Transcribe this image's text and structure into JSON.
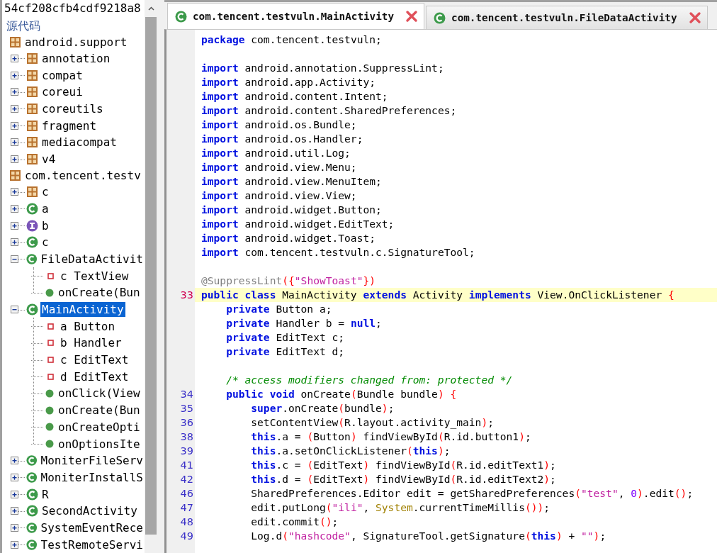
{
  "tree": {
    "title": "54cf208cfb4cdf9218a8",
    "root": "源代码",
    "children": [
      {
        "kind": "package",
        "label": "android.support",
        "selected": false,
        "children": [
          {
            "kind": "package",
            "label": "annotation",
            "expanded": false,
            "selected": false
          },
          {
            "kind": "package",
            "label": "compat",
            "expanded": false,
            "selected": false
          },
          {
            "kind": "package",
            "label": "coreui",
            "expanded": false,
            "selected": false
          },
          {
            "kind": "package",
            "label": "coreutils",
            "expanded": false,
            "selected": false
          },
          {
            "kind": "package",
            "label": "fragment",
            "expanded": false,
            "selected": false
          },
          {
            "kind": "package",
            "label": "mediacompat",
            "expanded": false,
            "selected": false
          },
          {
            "kind": "package",
            "label": "v4",
            "expanded": false,
            "selected": false
          }
        ]
      },
      {
        "kind": "package",
        "label": "com.tencent.testv",
        "selected": false,
        "children": [
          {
            "kind": "package",
            "label": "c",
            "expanded": false,
            "selected": false
          },
          {
            "kind": "class",
            "label": "a",
            "expanded": false,
            "selected": false
          },
          {
            "kind": "interface",
            "label": "b",
            "expanded": false,
            "selected": false
          },
          {
            "kind": "class",
            "label": "c",
            "expanded": false,
            "selected": false
          },
          {
            "kind": "class",
            "label": "FileDataActivit",
            "expanded": true,
            "selected": false,
            "children": [
              {
                "kind": "field",
                "label": "c TextView",
                "selected": false
              },
              {
                "kind": "method",
                "label": "onCreate(Bun",
                "selected": false
              }
            ]
          },
          {
            "kind": "class",
            "label": "MainActivity",
            "expanded": true,
            "selected": true,
            "children": [
              {
                "kind": "field",
                "label": "a Button",
                "selected": false
              },
              {
                "kind": "field",
                "label": "b Handler",
                "selected": false
              },
              {
                "kind": "field",
                "label": "c EditText",
                "selected": false
              },
              {
                "kind": "field",
                "label": "d EditText",
                "selected": false
              },
              {
                "kind": "method",
                "label": "onClick(View",
                "selected": false
              },
              {
                "kind": "method",
                "label": "onCreate(Bun",
                "selected": false
              },
              {
                "kind": "method",
                "label": "onCreateOpti",
                "selected": false
              },
              {
                "kind": "method",
                "label": "onOptionsIte",
                "selected": false
              }
            ]
          },
          {
            "kind": "class",
            "label": "MoniterFileServ",
            "expanded": false,
            "selected": false
          },
          {
            "kind": "class",
            "label": "MoniterInstallS",
            "expanded": false,
            "selected": false
          },
          {
            "kind": "class",
            "label": "R",
            "expanded": false,
            "selected": false
          },
          {
            "kind": "class",
            "label": "SecondActivity",
            "expanded": false,
            "selected": false
          },
          {
            "kind": "class",
            "label": "SystemEventRece",
            "expanded": false,
            "selected": false
          },
          {
            "kind": "class",
            "label": "TestRemoteServi",
            "expanded": false,
            "selected": false
          }
        ]
      }
    ]
  },
  "editor": {
    "tabs": [
      {
        "label": "com.tencent.testvuln.MainActivity",
        "selected": true
      },
      {
        "label": "com.tencent.testvuln.FileDataActivity",
        "selected": false
      }
    ],
    "lines": [
      {
        "tokens": [
          {
            "kind": "kw",
            "text": "package"
          },
          {
            "kind": "plain",
            "text": " com.tencent.testvuln;"
          }
        ]
      },
      {
        "kind": "blank"
      },
      {
        "tokens": [
          {
            "kind": "kw",
            "text": "import"
          },
          {
            "kind": "plain",
            "text": " android.annotation.SuppressLint;"
          }
        ]
      },
      {
        "tokens": [
          {
            "kind": "kw",
            "text": "import"
          },
          {
            "kind": "plain",
            "text": " android.app.Activity;"
          }
        ]
      },
      {
        "tokens": [
          {
            "kind": "kw",
            "text": "import"
          },
          {
            "kind": "plain",
            "text": " android.content.Intent;"
          }
        ]
      },
      {
        "tokens": [
          {
            "kind": "kw",
            "text": "import"
          },
          {
            "kind": "plain",
            "text": " android.content.SharedPreferences;"
          }
        ]
      },
      {
        "tokens": [
          {
            "kind": "kw",
            "text": "import"
          },
          {
            "kind": "plain",
            "text": " android.os.Bundle;"
          }
        ]
      },
      {
        "tokens": [
          {
            "kind": "kw",
            "text": "import"
          },
          {
            "kind": "plain",
            "text": " android.os.Handler;"
          }
        ]
      },
      {
        "tokens": [
          {
            "kind": "kw",
            "text": "import"
          },
          {
            "kind": "plain",
            "text": " android.util.Log;"
          }
        ]
      },
      {
        "tokens": [
          {
            "kind": "kw",
            "text": "import"
          },
          {
            "kind": "plain",
            "text": " android.view.Menu;"
          }
        ]
      },
      {
        "tokens": [
          {
            "kind": "kw",
            "text": "import"
          },
          {
            "kind": "plain",
            "text": " android.view.MenuItem;"
          }
        ]
      },
      {
        "tokens": [
          {
            "kind": "kw",
            "text": "import"
          },
          {
            "kind": "plain",
            "text": " android.view.View;"
          }
        ]
      },
      {
        "tokens": [
          {
            "kind": "kw",
            "text": "import"
          },
          {
            "kind": "plain",
            "text": " android.widget.Button;"
          }
        ]
      },
      {
        "tokens": [
          {
            "kind": "kw",
            "text": "import"
          },
          {
            "kind": "plain",
            "text": " android.widget.EditText;"
          }
        ]
      },
      {
        "tokens": [
          {
            "kind": "kw",
            "text": "import"
          },
          {
            "kind": "plain",
            "text": " android.widget.Toast;"
          }
        ]
      },
      {
        "tokens": [
          {
            "kind": "kw",
            "text": "import"
          },
          {
            "kind": "plain",
            "text": " com.tencent.testvuln.c.SignatureTool;"
          }
        ]
      },
      {
        "kind": "blank"
      },
      {
        "tokens": [
          {
            "kind": "annot",
            "text": "@SuppressLint"
          },
          {
            "kind": "paren",
            "text": "({"
          },
          {
            "kind": "str",
            "text": "\"ShowToast\""
          },
          {
            "kind": "paren",
            "text": "})"
          }
        ]
      },
      {
        "number": "33",
        "highlighted": true,
        "tokens": [
          {
            "kind": "kw",
            "text": "public class"
          },
          {
            "kind": "plain",
            "text": " MainActivity "
          },
          {
            "kind": "kw",
            "text": "extends"
          },
          {
            "kind": "plain",
            "text": " Activity "
          },
          {
            "kind": "kw",
            "text": "implements"
          },
          {
            "kind": "plain",
            "text": " View.OnClickListener "
          },
          {
            "kind": "paren",
            "text": "{"
          }
        ]
      },
      {
        "tokens": [
          {
            "kind": "kw",
            "text": "    private"
          },
          {
            "kind": "plain",
            "text": " Button a;"
          }
        ]
      },
      {
        "tokens": [
          {
            "kind": "kw",
            "text": "    private"
          },
          {
            "kind": "plain",
            "text": " Handler b = "
          },
          {
            "kind": "kw",
            "text": "null"
          },
          {
            "kind": "plain",
            "text": ";"
          }
        ]
      },
      {
        "tokens": [
          {
            "kind": "kw",
            "text": "    private"
          },
          {
            "kind": "plain",
            "text": " EditText c;"
          }
        ]
      },
      {
        "tokens": [
          {
            "kind": "kw",
            "text": "    private"
          },
          {
            "kind": "plain",
            "text": " EditText d;"
          }
        ]
      },
      {
        "kind": "blank"
      },
      {
        "tokens": [
          {
            "kind": "comment",
            "text": "    /* access modifiers changed from: protected */"
          }
        ]
      },
      {
        "number": "34",
        "tokens": [
          {
            "kind": "kw",
            "text": "    public void"
          },
          {
            "kind": "plain",
            "text": " onCreate"
          },
          {
            "kind": "paren",
            "text": "("
          },
          {
            "kind": "plain",
            "text": "Bundle bundle"
          },
          {
            "kind": "paren",
            "text": ") {"
          }
        ]
      },
      {
        "number": "35",
        "tokens": [
          {
            "kind": "kw",
            "text": "        super"
          },
          {
            "kind": "plain",
            "text": ".onCreate"
          },
          {
            "kind": "paren",
            "text": "("
          },
          {
            "kind": "plain",
            "text": "bundle"
          },
          {
            "kind": "paren",
            "text": ")"
          },
          {
            "kind": "plain",
            "text": ";"
          }
        ]
      },
      {
        "number": "36",
        "tokens": [
          {
            "kind": "plain",
            "text": "        setContentView"
          },
          {
            "kind": "paren",
            "text": "("
          },
          {
            "kind": "plain",
            "text": "R.layout.activity_main"
          },
          {
            "kind": "paren",
            "text": ")"
          },
          {
            "kind": "plain",
            "text": ";"
          }
        ]
      },
      {
        "number": "38",
        "tokens": [
          {
            "kind": "kw",
            "text": "        this"
          },
          {
            "kind": "plain",
            "text": ".a = "
          },
          {
            "kind": "paren",
            "text": "("
          },
          {
            "kind": "plain",
            "text": "Button"
          },
          {
            "kind": "paren",
            "text": ")"
          },
          {
            "kind": "plain",
            "text": " findViewById"
          },
          {
            "kind": "paren",
            "text": "("
          },
          {
            "kind": "plain",
            "text": "R.id.button1"
          },
          {
            "kind": "paren",
            "text": ")"
          },
          {
            "kind": "plain",
            "text": ";"
          }
        ]
      },
      {
        "number": "39",
        "tokens": [
          {
            "kind": "kw",
            "text": "        this"
          },
          {
            "kind": "plain",
            "text": ".a.setOnClickListener"
          },
          {
            "kind": "paren",
            "text": "("
          },
          {
            "kind": "kw",
            "text": "this"
          },
          {
            "kind": "paren",
            "text": ")"
          },
          {
            "kind": "plain",
            "text": ";"
          }
        ]
      },
      {
        "number": "41",
        "tokens": [
          {
            "kind": "kw",
            "text": "        this"
          },
          {
            "kind": "plain",
            "text": ".c = "
          },
          {
            "kind": "paren",
            "text": "("
          },
          {
            "kind": "plain",
            "text": "EditText"
          },
          {
            "kind": "paren",
            "text": ")"
          },
          {
            "kind": "plain",
            "text": " findViewById"
          },
          {
            "kind": "paren",
            "text": "("
          },
          {
            "kind": "plain",
            "text": "R.id.editText1"
          },
          {
            "kind": "paren",
            "text": ")"
          },
          {
            "kind": "plain",
            "text": ";"
          }
        ]
      },
      {
        "number": "42",
        "tokens": [
          {
            "kind": "kw",
            "text": "        this"
          },
          {
            "kind": "plain",
            "text": ".d = "
          },
          {
            "kind": "paren",
            "text": "("
          },
          {
            "kind": "plain",
            "text": "EditText"
          },
          {
            "kind": "paren",
            "text": ")"
          },
          {
            "kind": "plain",
            "text": " findViewById"
          },
          {
            "kind": "paren",
            "text": "("
          },
          {
            "kind": "plain",
            "text": "R.id.editText2"
          },
          {
            "kind": "paren",
            "text": ")"
          },
          {
            "kind": "plain",
            "text": ";"
          }
        ]
      },
      {
        "number": "46",
        "tokens": [
          {
            "kind": "plain",
            "text": "        SharedPreferences.Editor edit = getSharedPreferences"
          },
          {
            "kind": "paren",
            "text": "("
          },
          {
            "kind": "str",
            "text": "\"test\""
          },
          {
            "kind": "plain",
            "text": ", "
          },
          {
            "kind": "num",
            "text": "0"
          },
          {
            "kind": "paren",
            "text": ")"
          },
          {
            "kind": "plain",
            "text": ".edit"
          },
          {
            "kind": "paren",
            "text": "()"
          },
          {
            "kind": "plain",
            "text": ";"
          }
        ]
      },
      {
        "number": "47",
        "tokens": [
          {
            "kind": "plain",
            "text": "        edit.putLong"
          },
          {
            "kind": "paren",
            "text": "("
          },
          {
            "kind": "str",
            "text": "\"ili\""
          },
          {
            "kind": "plain",
            "text": ", "
          },
          {
            "kind": "sys",
            "text": "System"
          },
          {
            "kind": "plain",
            "text": ".currentTimeMillis"
          },
          {
            "kind": "paren",
            "text": "())"
          },
          {
            "kind": "plain",
            "text": ";"
          }
        ]
      },
      {
        "number": "48",
        "tokens": [
          {
            "kind": "plain",
            "text": "        edit.commit"
          },
          {
            "kind": "paren",
            "text": "()"
          },
          {
            "kind": "plain",
            "text": ";"
          }
        ]
      },
      {
        "number": "49",
        "tokens": [
          {
            "kind": "plain",
            "text": "        Log.d"
          },
          {
            "kind": "paren",
            "text": "("
          },
          {
            "kind": "str",
            "text": "\"hashcode\""
          },
          {
            "kind": "plain",
            "text": ", SignatureTool.getSignature"
          },
          {
            "kind": "paren",
            "text": "("
          },
          {
            "kind": "kw",
            "text": "this"
          },
          {
            "kind": "paren",
            "text": ")"
          },
          {
            "kind": "plain",
            "text": " + "
          },
          {
            "kind": "str",
            "text": "\"\""
          },
          {
            "kind": "paren",
            "text": ")"
          },
          {
            "kind": "plain",
            "text": ";"
          }
        ]
      }
    ]
  }
}
